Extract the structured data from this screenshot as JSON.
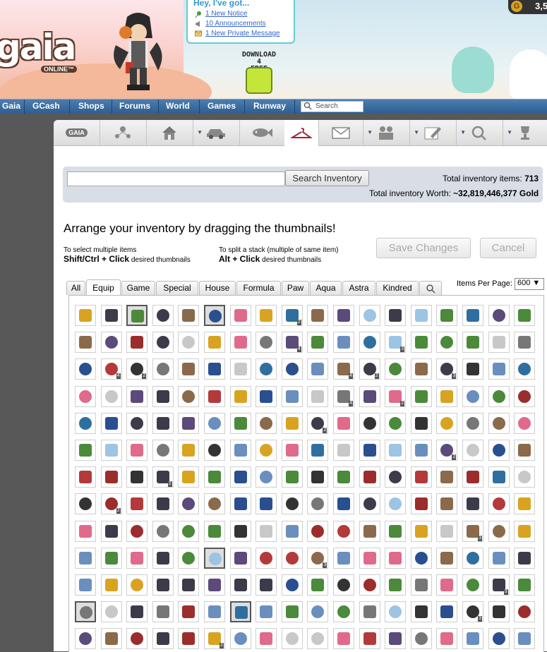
{
  "header": {
    "logo_text": "gaia",
    "logo_sub": "ONLINE™",
    "gold_amount": "3,5",
    "coin_letter": "G",
    "notifications": {
      "heading": "Hey, I've got...",
      "items": [
        "1 New Notice",
        "10 Announcements",
        "1 New Private Message"
      ]
    },
    "download_lines": [
      "DOWNLOAD",
      "4",
      "FREE"
    ]
  },
  "nav": {
    "items": [
      "Gaia",
      "GCash",
      "Shops",
      "Forums",
      "World",
      "Games",
      "Runway"
    ],
    "search_placeholder": "Search"
  },
  "toolbar": {
    "logo_label": "GAIA",
    "icons": [
      "gaia-logo-icon",
      "network-icon",
      "house-icon",
      "car-icon",
      "fish-icon",
      "hanger-icon",
      "envelope-icon",
      "people-icon",
      "pencil-icon",
      "search-icon",
      "trophy-icon"
    ]
  },
  "inventory": {
    "search_button": "Search Inventory",
    "search_value": "",
    "total_items_label": "Total inventory items:",
    "total_items": "713",
    "total_worth_label": "Total inventory Worth:",
    "total_worth": "~32,819,446,377 Gold",
    "instruction": "Arrange your inventory by dragging the thumbnails!",
    "multi_select_hint": "To select multiple items",
    "multi_select_keys": "Shift/Ctrl + Click",
    "multi_select_suffix": "desired thumbnails",
    "split_hint": "To split a stack (multiple of same item)",
    "split_keys": "Alt + Click",
    "split_suffix": "desired thumbnails",
    "save_label": "Save Changes",
    "cancel_label": "Cancel",
    "items_per_page_label": "Items Per Page:",
    "items_per_page_value": "600 ▼",
    "tabs": [
      "All",
      "Equip",
      "Game",
      "Special",
      "House",
      "Formula",
      "Paw",
      "Aqua",
      "Astra",
      "Kindred"
    ],
    "active_tab": "Equip"
  },
  "colors": {
    "nav_bg": "#3b6c9f",
    "page_bg": "#585858",
    "search_panel_bg": "#d9dde6",
    "active_toolbar_icon": "#a0243a"
  }
}
